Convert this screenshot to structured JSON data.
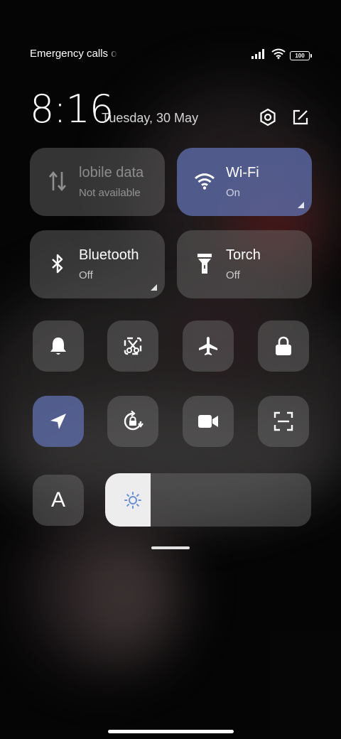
{
  "status_bar": {
    "carrier_text": "Emergency calls o",
    "battery_level": "100"
  },
  "header": {
    "time": "8:16",
    "date": "Tuesday, 30 May"
  },
  "tiles": {
    "mobile_data": {
      "label": "lobile data",
      "state": "Not available",
      "icon": "mobile-data-icon"
    },
    "wifi": {
      "label": "Wi-Fi",
      "state": "On",
      "icon": "wifi-icon"
    },
    "bluetooth": {
      "label": "Bluetooth",
      "state": "Off",
      "icon": "bluetooth-icon"
    },
    "torch": {
      "label": "Torch",
      "state": "Off",
      "icon": "torch-icon"
    }
  },
  "toggles_row1": [
    "bell-icon",
    "screenshot-icon",
    "airplane-icon",
    "lock-icon"
  ],
  "toggles_row2": [
    "location-icon",
    "rotation-lock-icon",
    "video-camera-icon",
    "scan-icon"
  ],
  "font_tile": {
    "glyph": "A"
  },
  "brightness": {
    "level": 0.22,
    "icon": "brightness-icon"
  },
  "colors": {
    "active_tile": "#5c6ca8",
    "inactive_tile": "#787878",
    "accent_icon": "#6b8fd6"
  }
}
